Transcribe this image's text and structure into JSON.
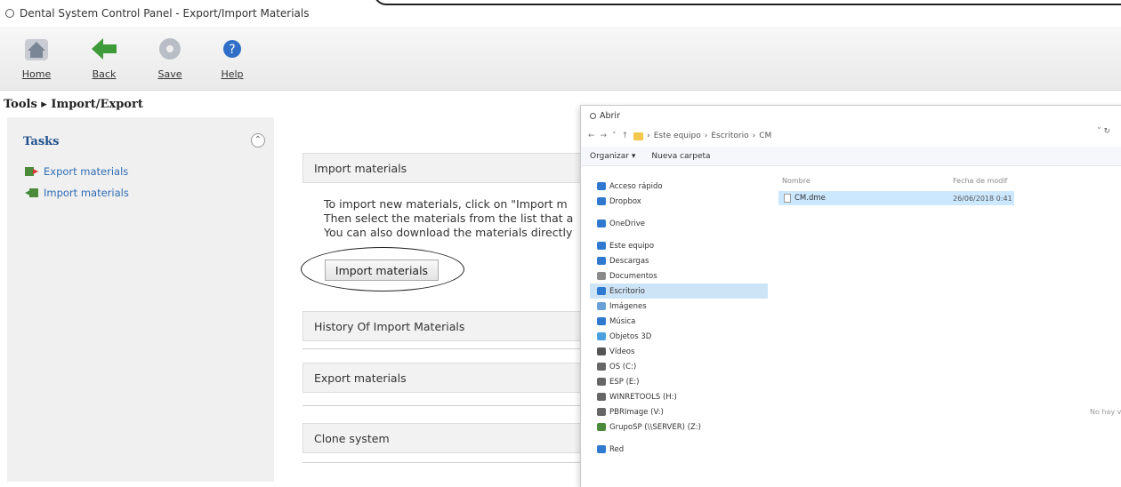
{
  "window": {
    "title": "Dental System Control Panel - Export/Import Materials"
  },
  "toolbar": {
    "home_label": "Home",
    "back_label": "Back",
    "save_label": "Save",
    "help_label": "Help"
  },
  "breadcrumb": {
    "text": "Tools ▸ Import/Export"
  },
  "sidebar": {
    "title": "Tasks",
    "items": [
      {
        "label": "Export materials"
      },
      {
        "label": "Import materials"
      }
    ]
  },
  "main": {
    "sections": [
      {
        "label": "Import materials"
      },
      {
        "label": "History Of Import Materials"
      },
      {
        "label": "Export materials"
      },
      {
        "label": "Clone system"
      }
    ],
    "import_desc": [
      "To import new materials, click on \"Import m",
      "Then select the materials from the list that a",
      "You can also download the materials directly"
    ],
    "import_button": "Import materials"
  },
  "dialog": {
    "title": "Abrir",
    "path": [
      "Este equipo",
      "Escritorio",
      "CM"
    ],
    "organize": "Organizar ▾",
    "new_folder": "Nueva carpeta",
    "nav": [
      {
        "label": "Acceso rápido",
        "icon": "star-icon"
      },
      {
        "label": "Dropbox",
        "icon": "dropbox-icon"
      },
      {
        "label": "OneDrive",
        "icon": "cloud-icon"
      },
      {
        "label": "Este equipo",
        "icon": "computer-icon"
      },
      {
        "label": "Descargas",
        "icon": "download-icon"
      },
      {
        "label": "Documentos",
        "icon": "document-icon"
      },
      {
        "label": "Escritorio",
        "icon": "desktop-icon",
        "selected": true
      },
      {
        "label": "Imágenes",
        "icon": "image-icon"
      },
      {
        "label": "Música",
        "icon": "music-icon"
      },
      {
        "label": "Objetos 3D",
        "icon": "cube-icon"
      },
      {
        "label": "Vídeos",
        "icon": "video-icon"
      },
      {
        "label": "OS (C:)",
        "icon": "drive-icon"
      },
      {
        "label": "ESP (E:)",
        "icon": "drive-icon"
      },
      {
        "label": "WINRETOOLS (H:)",
        "icon": "drive-icon"
      },
      {
        "label": "PBRImage (V:)",
        "icon": "drive-icon"
      },
      {
        "label": "GrupoSP (\\\\SERVER) (Z:)",
        "icon": "network-drive-icon"
      },
      {
        "label": "Red",
        "icon": "network-icon"
      }
    ],
    "col_name": "Nombre",
    "col_date": "Fecha de modif",
    "file_name": "CM.dme",
    "file_date": "26/06/2018 0:41",
    "empty_note": "No hay ve"
  }
}
